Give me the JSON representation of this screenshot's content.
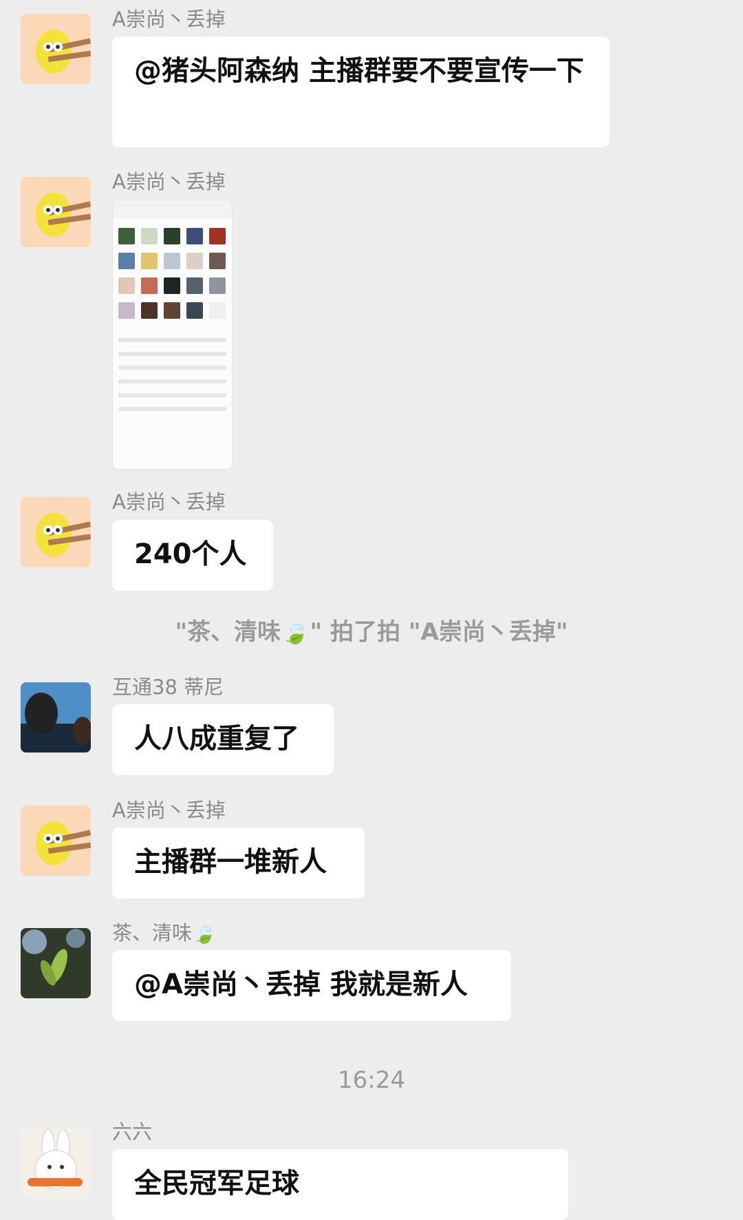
{
  "messages": [
    {
      "sender": "A崇尚丶丢掉",
      "text": "@猪头阿森纳 主播群要不要宣传一下"
    },
    {
      "sender": "A崇尚丶丢掉",
      "image": "group-members-screenshot"
    },
    {
      "sender": "A崇尚丶丢掉",
      "text": "240个人"
    },
    {
      "system": "\"茶、清味🍃\" 拍了拍 \"A崇尚丶丢掉\""
    },
    {
      "sender": "互通38 蒂尼",
      "text": "人八成重复了"
    },
    {
      "sender": "A崇尚丶丢掉",
      "text": "主播群一堆新人"
    },
    {
      "sender": "茶、清味🍃",
      "text": "@A崇尚丶丢掉 我就是新人"
    },
    {
      "time": "16:24"
    },
    {
      "sender": "六六",
      "text": "全民冠军足球"
    }
  ],
  "colors": {
    "background": "#ededed",
    "bubble": "#ffffff",
    "name": "#8a8a8a",
    "system": "#9a9a9a"
  }
}
